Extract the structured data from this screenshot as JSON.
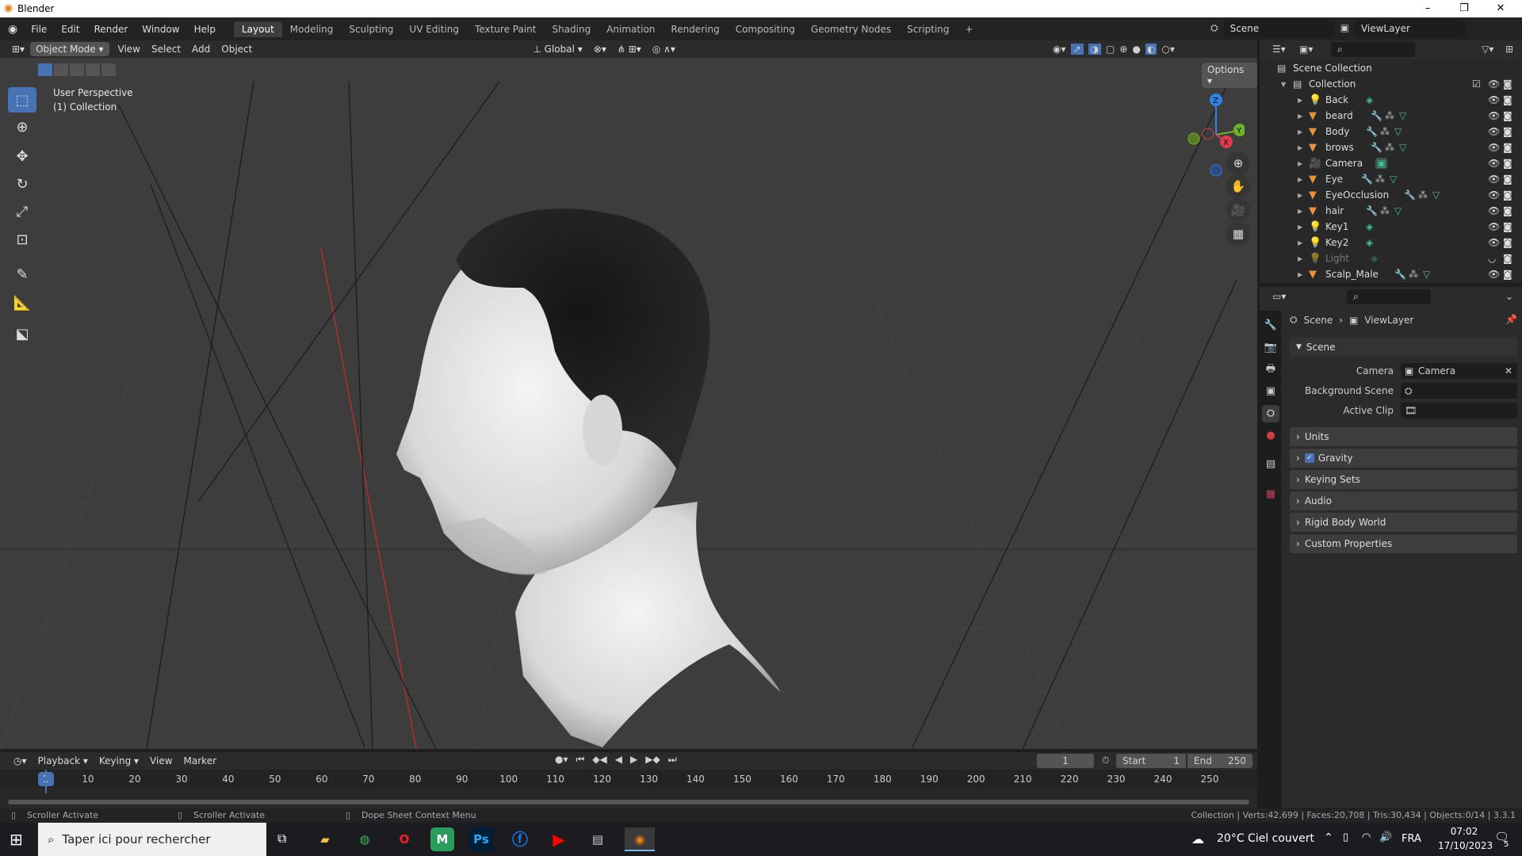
{
  "window": {
    "title": "Blender",
    "minimize": "–",
    "maximize": "❐",
    "close": "✕"
  },
  "menu": [
    "File",
    "Edit",
    "Render",
    "Window",
    "Help"
  ],
  "workspaces": [
    "Layout",
    "Modeling",
    "Sculpting",
    "UV Editing",
    "Texture Paint",
    "Shading",
    "Animation",
    "Rendering",
    "Compositing",
    "Geometry Nodes",
    "Scripting"
  ],
  "add_workspace": "+",
  "scene": {
    "name": "Scene",
    "view_layer": "ViewLayer"
  },
  "viewport_header": {
    "mode": "Object Mode",
    "menus": [
      "View",
      "Select",
      "Add",
      "Object"
    ],
    "orientation": "Global",
    "options": "Options"
  },
  "viewport": {
    "perspective": "User Perspective",
    "collection": "(1) Collection",
    "gizmo": {
      "z": "Z",
      "y": "Y",
      "x": "X"
    }
  },
  "outliner": {
    "root": "Scene Collection",
    "collection": "Collection",
    "items": [
      {
        "name": "Back",
        "type": "light"
      },
      {
        "name": "beard",
        "type": "mesh"
      },
      {
        "name": "Body",
        "type": "mesh"
      },
      {
        "name": "brows",
        "type": "mesh"
      },
      {
        "name": "Camera",
        "type": "camera"
      },
      {
        "name": "Eye",
        "type": "mesh"
      },
      {
        "name": "EyeOcclusion",
        "type": "mesh"
      },
      {
        "name": "hair",
        "type": "mesh"
      },
      {
        "name": "Key1",
        "type": "light"
      },
      {
        "name": "Key2",
        "type": "light"
      },
      {
        "name": "Light",
        "type": "light",
        "hidden": true
      },
      {
        "name": "Scalp_Male",
        "type": "mesh"
      }
    ]
  },
  "properties": {
    "breadcrumb": [
      "Scene",
      "ViewLayer"
    ],
    "panel": "Scene",
    "fields": [
      {
        "label": "Camera",
        "value": "Camera"
      },
      {
        "label": "Background Scene",
        "value": ""
      },
      {
        "label": "Active Clip",
        "value": ""
      }
    ],
    "sections": [
      {
        "label": "Units"
      },
      {
        "label": "Gravity",
        "checked": true
      },
      {
        "label": "Keying Sets"
      },
      {
        "label": "Audio"
      },
      {
        "label": "Rigid Body World"
      },
      {
        "label": "Custom Properties"
      }
    ]
  },
  "timeline": {
    "menus": [
      "Playback",
      "Keying",
      "View",
      "Marker"
    ],
    "current_frame": "1",
    "start_label": "Start",
    "start": "1",
    "end_label": "End",
    "end": "250",
    "ticks": [
      10,
      20,
      30,
      40,
      50,
      60,
      70,
      80,
      90,
      100,
      110,
      120,
      130,
      140,
      150,
      160,
      170,
      180,
      190,
      200,
      210,
      220,
      230,
      240,
      250
    ],
    "current": "1"
  },
  "status": {
    "left1": "Scroller Activate",
    "left2": "Scroller Activate",
    "left3": "Dope Sheet Context Menu",
    "stats": "Collection | Verts:42,699 | Faces:20,708 | Tris:30,434 | Objects:0/14 | 3.3.1"
  },
  "taskbar": {
    "search": "Taper ici pour rechercher",
    "weather": "20°C  Ciel couvert",
    "lang": "FRA",
    "time": "07:02",
    "date": "17/10/2023",
    "notif": "5"
  }
}
